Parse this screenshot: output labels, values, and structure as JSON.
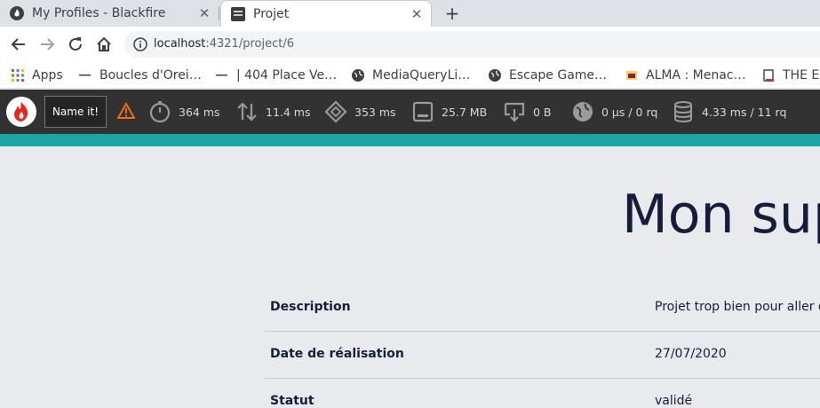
{
  "tabs": [
    {
      "title": "My Profiles - Blackfire",
      "close": "✕"
    },
    {
      "title": "Projet",
      "close": "✕"
    }
  ],
  "new_tab_label": "+",
  "address": {
    "host": "localhost",
    "rest": ":4321/project/6"
  },
  "bookmarks": [
    {
      "label": "Apps",
      "icon": "apps-grid-icon"
    },
    {
      "label": "Boucles d'Orei…",
      "icon": "dash-icon"
    },
    {
      "label": "| 404 Place Ve…",
      "icon": "dash-icon"
    },
    {
      "label": "MediaQueryLi…",
      "icon": "globe-icon"
    },
    {
      "label": "Escape Game…",
      "icon": "globe-icon"
    },
    {
      "label": "ALMA : Menac…",
      "icon": "alma-icon"
    },
    {
      "label": "THE ES",
      "icon": "page-icon"
    }
  ],
  "blackfire": {
    "name_button": "Name it!",
    "metrics": [
      {
        "value": "364 ms",
        "icon": "stopwatch-icon"
      },
      {
        "value": "11.4 ms",
        "icon": "io-arrows-icon"
      },
      {
        "value": "353 ms",
        "icon": "cpu-icon"
      },
      {
        "value": "25.7 MB",
        "icon": "memory-icon"
      },
      {
        "value": "0 B",
        "icon": "network-icon"
      },
      {
        "value": "0 µs / 0 rq",
        "icon": "http-globe-icon"
      },
      {
        "value": "4.33 ms / 11 rq",
        "icon": "database-icon"
      }
    ],
    "accent": "#1aa6a6"
  },
  "page": {
    "heading": "Mon sup",
    "rows": [
      {
        "label": "Description",
        "value": "Projet trop bien pour aller da"
      },
      {
        "label": "Date de réalisation",
        "value": "27/07/2020"
      },
      {
        "label": "Statut",
        "value": "validé"
      }
    ]
  }
}
